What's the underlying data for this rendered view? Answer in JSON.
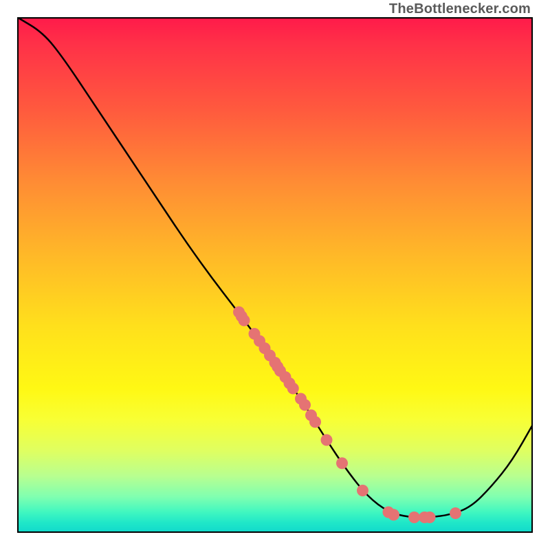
{
  "watermark": "TheBottlenecker.com",
  "chart_data": {
    "type": "line",
    "title": "",
    "xlabel": "",
    "ylabel": "",
    "xlim": [
      0,
      100
    ],
    "ylim": [
      0,
      100
    ],
    "curve": [
      {
        "x": 0,
        "y": 100
      },
      {
        "x": 5,
        "y": 97
      },
      {
        "x": 9,
        "y": 92
      },
      {
        "x": 15,
        "y": 83
      },
      {
        "x": 25,
        "y": 68
      },
      {
        "x": 35,
        "y": 53
      },
      {
        "x": 45,
        "y": 40
      },
      {
        "x": 50,
        "y": 33
      },
      {
        "x": 55,
        "y": 26
      },
      {
        "x": 60,
        "y": 18
      },
      {
        "x": 64,
        "y": 12
      },
      {
        "x": 68,
        "y": 7
      },
      {
        "x": 72,
        "y": 4
      },
      {
        "x": 76,
        "y": 3
      },
      {
        "x": 80,
        "y": 3
      },
      {
        "x": 84,
        "y": 3.5
      },
      {
        "x": 88,
        "y": 5
      },
      {
        "x": 92,
        "y": 9
      },
      {
        "x": 96,
        "y": 14
      },
      {
        "x": 100,
        "y": 21
      }
    ],
    "points": [
      {
        "x": 43,
        "y": 42.8
      },
      {
        "x": 43.5,
        "y": 42.0
      },
      {
        "x": 44,
        "y": 41.2
      },
      {
        "x": 46,
        "y": 38.6
      },
      {
        "x": 47,
        "y": 37.2
      },
      {
        "x": 48,
        "y": 35.8
      },
      {
        "x": 49,
        "y": 34.4
      },
      {
        "x": 50,
        "y": 33.0
      },
      {
        "x": 50.5,
        "y": 32.2
      },
      {
        "x": 51,
        "y": 31.4
      },
      {
        "x": 52,
        "y": 30.2
      },
      {
        "x": 52.8,
        "y": 29.0
      },
      {
        "x": 53.5,
        "y": 28.0
      },
      {
        "x": 55,
        "y": 26.0
      },
      {
        "x": 55.8,
        "y": 24.8
      },
      {
        "x": 57,
        "y": 22.8
      },
      {
        "x": 57.8,
        "y": 21.5
      },
      {
        "x": 60,
        "y": 18.0
      },
      {
        "x": 63,
        "y": 13.5
      },
      {
        "x": 67,
        "y": 8.2
      },
      {
        "x": 72,
        "y": 4.0
      },
      {
        "x": 73,
        "y": 3.5
      },
      {
        "x": 77,
        "y": 3.0
      },
      {
        "x": 79,
        "y": 3.0
      },
      {
        "x": 80,
        "y": 3.0
      },
      {
        "x": 85,
        "y": 3.8
      }
    ],
    "point_color": "#e57373",
    "curve_color": "#000000"
  }
}
